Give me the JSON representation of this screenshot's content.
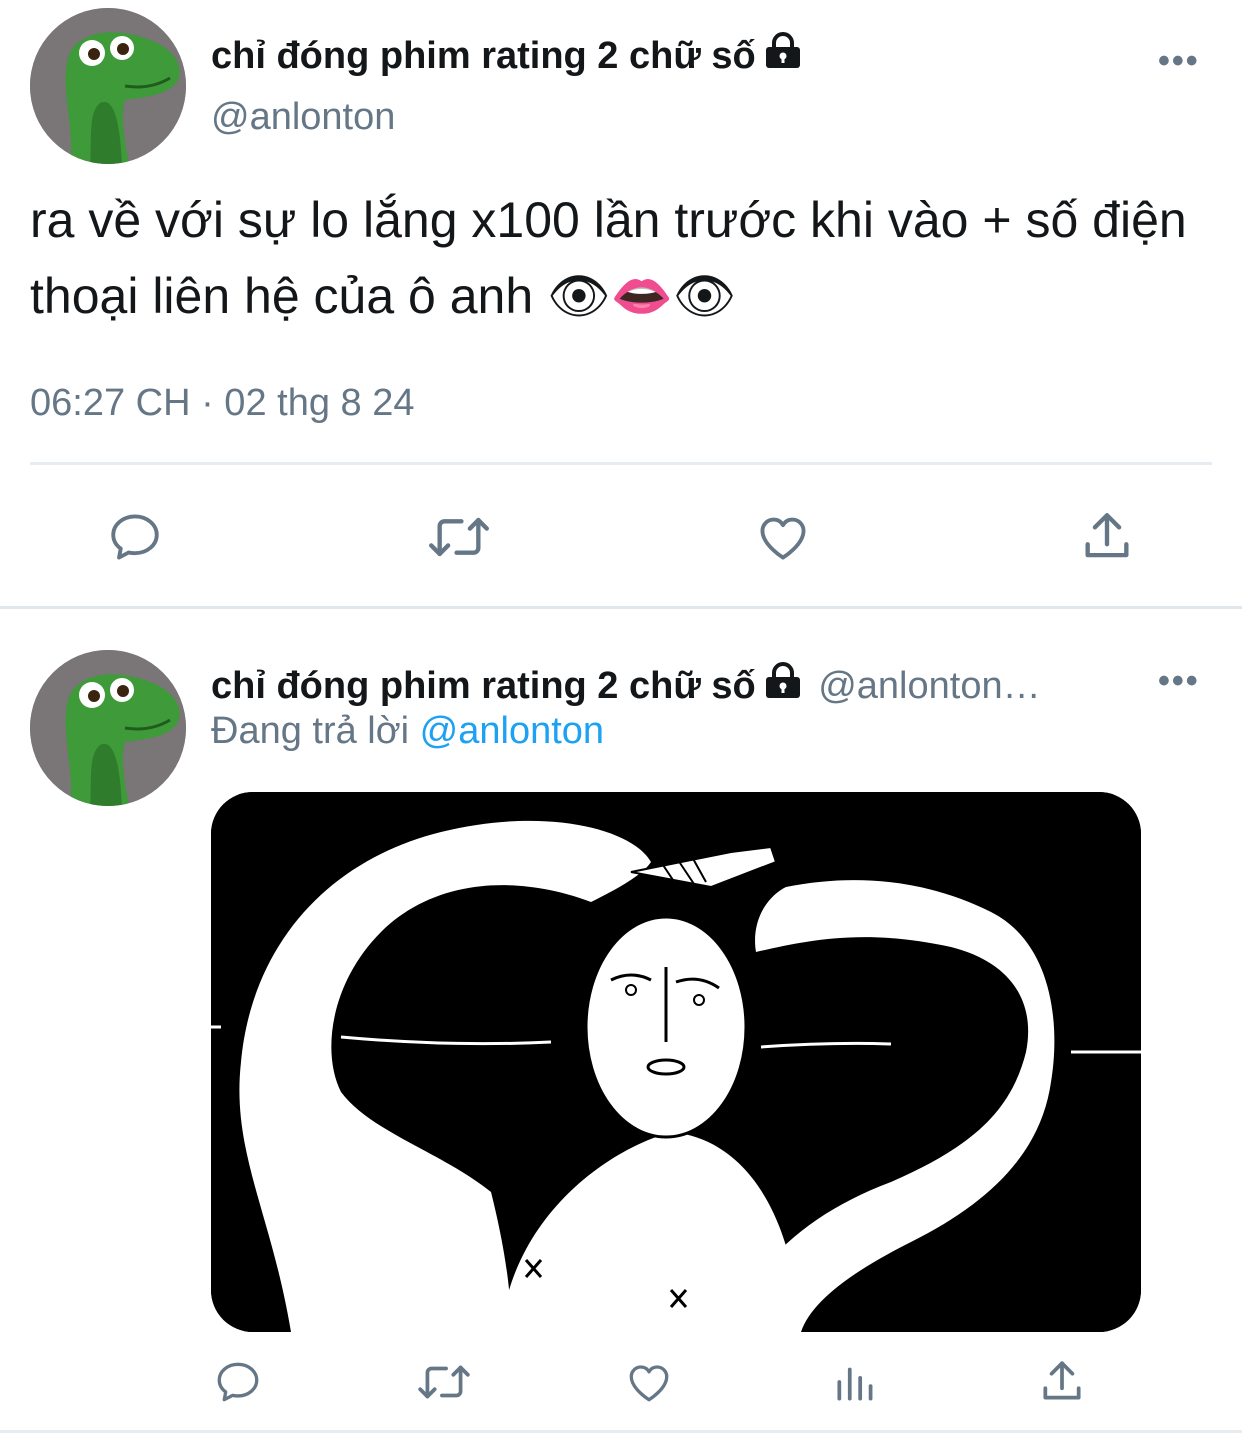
{
  "tweet": {
    "display_name": "chỉ đóng phim rating 2 chữ số",
    "handle": "@anlonton",
    "text": "ra về với sự lo lắng x100 lần trước khi vào + số điện thoại liên hệ của ô anh 👁👄👁",
    "timestamp": "06:27 CH · 02 thg 8 24",
    "more_label": "•••",
    "actions": [
      "reply-icon",
      "retweet-icon",
      "like-icon",
      "share-icon"
    ]
  },
  "reply": {
    "display_name": "chỉ đóng phim rating 2 chữ số",
    "handle": "@anlonton…",
    "replying_prefix": "Đang trả lời",
    "replying_to": "@anlonton",
    "more_label": "•••",
    "media_icons": [
      "reply-icon",
      "retweet-icon",
      "like-icon",
      "analytics-icon",
      "share-icon"
    ]
  },
  "colors": {
    "text": "#14171a",
    "secondary": "#657786",
    "accent": "#1da1f2",
    "divider": "#e6ecf0",
    "avatar_bg": "#7a7577"
  }
}
